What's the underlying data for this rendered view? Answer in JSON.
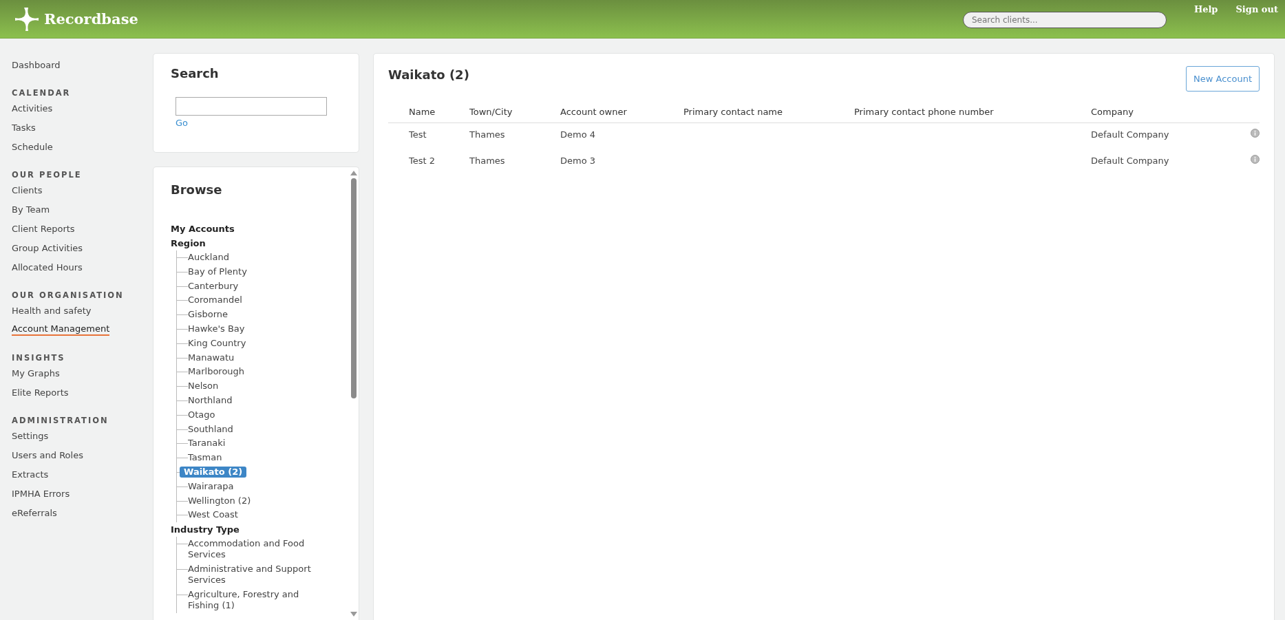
{
  "header": {
    "logo": "Recordbase",
    "search": {
      "placeholder": "Search clients..."
    },
    "links": [
      "Help",
      "Sign out"
    ]
  },
  "sidebar": {
    "sections": [
      {
        "items": [
          {
            "label": "Dashboard",
            "selected": false
          }
        ]
      },
      {
        "heading": "CALENDAR",
        "items": [
          {
            "label": "Activities",
            "selected": false
          },
          {
            "label": "Tasks",
            "selected": false
          },
          {
            "label": "Schedule",
            "selected": false
          }
        ]
      },
      {
        "heading": "OUR PEOPLE",
        "items": [
          {
            "label": "Clients",
            "selected": false
          },
          {
            "label": "By Team",
            "selected": false
          },
          {
            "label": "Client Reports",
            "selected": false
          },
          {
            "label": "Group Activities",
            "selected": false
          },
          {
            "label": "Allocated Hours",
            "selected": false
          }
        ]
      },
      {
        "heading": "OUR ORGANISATION",
        "items": [
          {
            "label": "Health and safety",
            "selected": false
          },
          {
            "label": "Account Management",
            "selected": true
          }
        ]
      },
      {
        "heading": "INSIGHTS",
        "items": [
          {
            "label": "My Graphs",
            "selected": false
          },
          {
            "label": "Elite Reports",
            "selected": false
          }
        ]
      },
      {
        "heading": "ADMINISTRATION",
        "items": [
          {
            "label": "Settings",
            "selected": false
          },
          {
            "label": "Users and Roles",
            "selected": false
          },
          {
            "label": "Extracts",
            "selected": false
          },
          {
            "label": "IPMHA Errors",
            "selected": false
          },
          {
            "label": "eReferrals",
            "selected": false
          }
        ]
      }
    ]
  },
  "search_panel": {
    "title": "Search",
    "link": "Go"
  },
  "browse": {
    "title": "Browse",
    "groups": [
      {
        "label": "My Accounts"
      },
      {
        "label": "Region",
        "children": [
          {
            "label": "Auckland",
            "selected": false
          },
          {
            "label": "Bay of Plenty",
            "selected": false
          },
          {
            "label": "Canterbury",
            "selected": false
          },
          {
            "label": "Coromandel",
            "selected": false
          },
          {
            "label": "Gisborne",
            "selected": false
          },
          {
            "label": "Hawke's Bay",
            "selected": false
          },
          {
            "label": "King Country",
            "selected": false
          },
          {
            "label": "Manawatu",
            "selected": false
          },
          {
            "label": "Marlborough",
            "selected": false
          },
          {
            "label": "Nelson",
            "selected": false
          },
          {
            "label": "Northland",
            "selected": false
          },
          {
            "label": "Otago",
            "selected": false
          },
          {
            "label": "Southland",
            "selected": false
          },
          {
            "label": "Taranaki",
            "selected": false
          },
          {
            "label": "Tasman",
            "selected": false
          },
          {
            "label": "Waikato (2)",
            "selected": true
          },
          {
            "label": "Wairarapa",
            "selected": false
          },
          {
            "label": "Wellington (2)",
            "selected": false
          },
          {
            "label": "West Coast",
            "selected": false
          }
        ]
      },
      {
        "label": "Industry Type",
        "children": [
          {
            "label": "Accommodation and Food Services",
            "selected": false
          },
          {
            "label": "Administrative and Support Services",
            "selected": false
          },
          {
            "label": "Agriculture, Forestry and Fishing (1)",
            "selected": false
          }
        ]
      }
    ]
  },
  "main": {
    "title": "Waikato (2)",
    "button": "New Account",
    "table": {
      "columns": [
        "Name",
        "Town/City",
        "Account owner",
        "Primary contact name",
        "Primary contact phone number",
        "Company"
      ],
      "rows": [
        [
          "Test",
          "Thames",
          "Demo 4",
          "",
          "",
          "Default Company"
        ],
        [
          "Test 2",
          "Thames",
          "Demo 3",
          "",
          "",
          "Default Company"
        ]
      ]
    }
  }
}
